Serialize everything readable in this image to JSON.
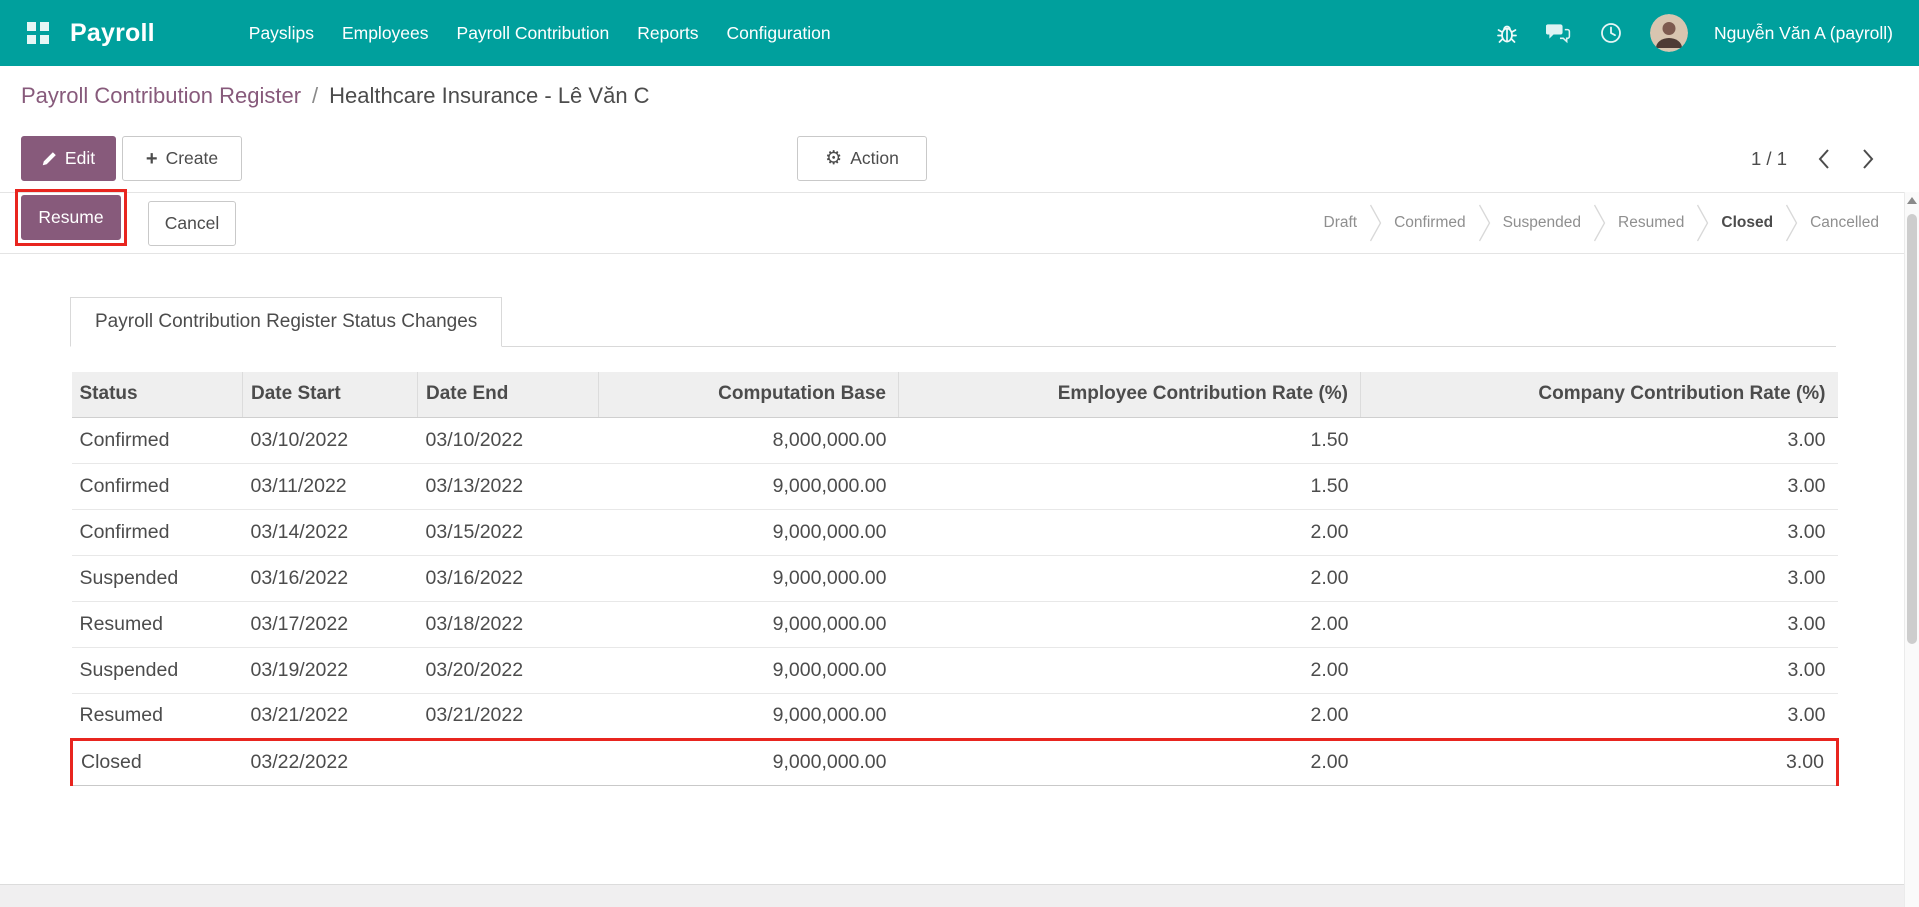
{
  "colors": {
    "navbar_bg": "#00a09d",
    "primary": "#875a7b",
    "link": "#875a7b",
    "text": "#4c4c4c",
    "muted_state": "#8f8f8f",
    "annotation_red": "#e8251f",
    "table_header_bg": "#efefef"
  },
  "navbar": {
    "brand": "Payroll",
    "menu": [
      {
        "label": "Payslips"
      },
      {
        "label": "Employees"
      },
      {
        "label": "Payroll Contribution"
      },
      {
        "label": "Reports"
      },
      {
        "label": "Configuration"
      }
    ],
    "user_name": "Nguyễn Văn A (payroll)"
  },
  "breadcrumb": {
    "parent": "Payroll Contribution Register",
    "separator": "/",
    "current": "Healthcare Insurance - Lê Văn C"
  },
  "control_panel": {
    "edit_label": "Edit",
    "create_label": "Create",
    "action_label": "Action",
    "pager_value": "1 / 1"
  },
  "statusbar": {
    "resume_label": "Resume",
    "cancel_label": "Cancel",
    "states": [
      {
        "label": "Draft",
        "active": false
      },
      {
        "label": "Confirmed",
        "active": false
      },
      {
        "label": "Suspended",
        "active": false
      },
      {
        "label": "Resumed",
        "active": false
      },
      {
        "label": "Closed",
        "active": true
      },
      {
        "label": "Cancelled",
        "active": false
      }
    ]
  },
  "notebook": {
    "active_tab_label": "Payroll Contribution Register Status Changes"
  },
  "table": {
    "headers": [
      "Status",
      "Date Start",
      "Date End",
      "Computation Base",
      "Employee Contribution Rate (%)",
      "Company Contribution Rate (%)"
    ],
    "rows": [
      {
        "highlighted": false,
        "cells": [
          "Confirmed",
          "03/10/2022",
          "03/10/2022",
          "8,000,000.00",
          "1.50",
          "3.00"
        ]
      },
      {
        "highlighted": false,
        "cells": [
          "Confirmed",
          "03/11/2022",
          "03/13/2022",
          "9,000,000.00",
          "1.50",
          "3.00"
        ]
      },
      {
        "highlighted": false,
        "cells": [
          "Confirmed",
          "03/14/2022",
          "03/15/2022",
          "9,000,000.00",
          "2.00",
          "3.00"
        ]
      },
      {
        "highlighted": false,
        "cells": [
          "Suspended",
          "03/16/2022",
          "03/16/2022",
          "9,000,000.00",
          "2.00",
          "3.00"
        ]
      },
      {
        "highlighted": false,
        "cells": [
          "Resumed",
          "03/17/2022",
          "03/18/2022",
          "9,000,000.00",
          "2.00",
          "3.00"
        ]
      },
      {
        "highlighted": false,
        "cells": [
          "Suspended",
          "03/19/2022",
          "03/20/2022",
          "9,000,000.00",
          "2.00",
          "3.00"
        ]
      },
      {
        "highlighted": false,
        "cells": [
          "Resumed",
          "03/21/2022",
          "03/21/2022",
          "9,000,000.00",
          "2.00",
          "3.00"
        ]
      },
      {
        "highlighted": true,
        "cells": [
          "Closed",
          "03/22/2022",
          "",
          "9,000,000.00",
          "2.00",
          "3.00"
        ]
      }
    ]
  }
}
